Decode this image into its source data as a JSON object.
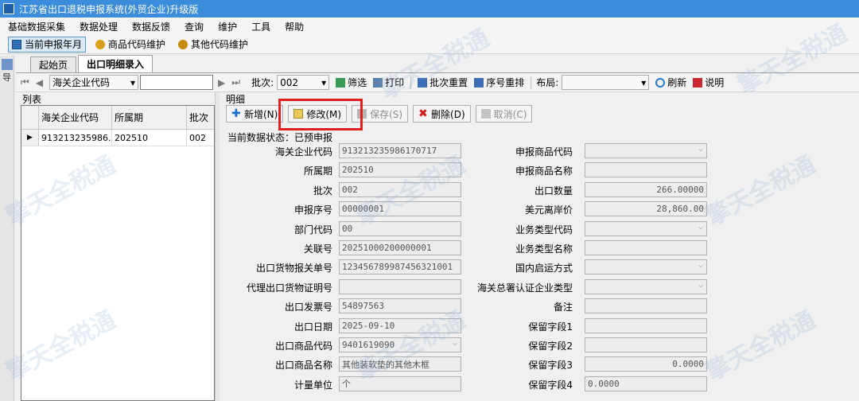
{
  "window": {
    "title": "江苏省出口退税申报系统(外贸企业)升级版"
  },
  "menu": [
    "基础数据采集",
    "数据处理",
    "数据反馈",
    "查询",
    "维护",
    "工具",
    "帮助"
  ],
  "quickbar": {
    "items": [
      {
        "label": "当前申报年月",
        "icon": "calendar-icon",
        "active": true
      },
      {
        "label": "商品代码维护",
        "icon": "gear-icon",
        "active": false
      },
      {
        "label": "其他代码维护",
        "icon": "gears-icon",
        "active": false
      }
    ]
  },
  "leftstrip": {
    "label": "导"
  },
  "tabs": [
    "起始页",
    "出口明细录入"
  ],
  "toolbar": {
    "field_select": "海关企业代码",
    "search_value": "",
    "batch_label": "批次:",
    "batch_value": "002",
    "filter": "筛选",
    "print": "打印",
    "batch_reset": "批次重置",
    "seq_rearrange": "序号重排",
    "layout_label": "布局:",
    "layout_value": "",
    "refresh": "刷新",
    "help": "说明"
  },
  "list": {
    "title": "列表",
    "headers": [
      "海关企业代码",
      "所属期",
      "批次"
    ],
    "rows": [
      [
        "913213235986...",
        "202510",
        "002"
      ]
    ]
  },
  "detail": {
    "title": "明细",
    "buttons": {
      "add": "新增(N)",
      "edit": "修改(M)",
      "save": "保存(S)",
      "delete": "删除(D)",
      "cancel": "取消(C)"
    },
    "status": "当前数据状态：已预申报",
    "left_fields": [
      {
        "label": "海关企业代码",
        "value": "913213235986170717"
      },
      {
        "label": "所属期",
        "value": "202510"
      },
      {
        "label": "批次",
        "value": "002"
      },
      {
        "label": "申报序号",
        "value": "00000001"
      },
      {
        "label": "部门代码",
        "value": "00"
      },
      {
        "label": "关联号",
        "value": "20251000200000001"
      },
      {
        "label": "出口货物报关单号",
        "value": "123456789987456321001"
      },
      {
        "label": "代理出口货物证明号",
        "value": ""
      },
      {
        "label": "出口发票号",
        "value": "54897563"
      },
      {
        "label": "出口日期",
        "value": "2025-09-10"
      },
      {
        "label": "出口商品代码",
        "value": "9401619090"
      },
      {
        "label": "出口商品名称",
        "value": "其他装软垫的其他木框"
      },
      {
        "label": "计量单位",
        "value": "个"
      }
    ],
    "right_fields": [
      {
        "label": "申报商品代码",
        "value": ""
      },
      {
        "label": "申报商品名称",
        "value": ""
      },
      {
        "label": "出口数量",
        "value": "266.00000"
      },
      {
        "label": "美元离岸价",
        "value": "28,860.00"
      },
      {
        "label": "业务类型代码",
        "value": ""
      },
      {
        "label": "业务类型名称",
        "value": ""
      },
      {
        "label": "国内启运方式",
        "value": ""
      },
      {
        "label": "海关总署认证企业类型",
        "value": ""
      },
      {
        "label": "备注",
        "value": ""
      },
      {
        "label": "保留字段1",
        "value": ""
      },
      {
        "label": "保留字段2",
        "value": ""
      },
      {
        "label": "保留字段3",
        "value": "0.0000"
      },
      {
        "label": "保留字段4",
        "value": "0.0000"
      }
    ]
  }
}
